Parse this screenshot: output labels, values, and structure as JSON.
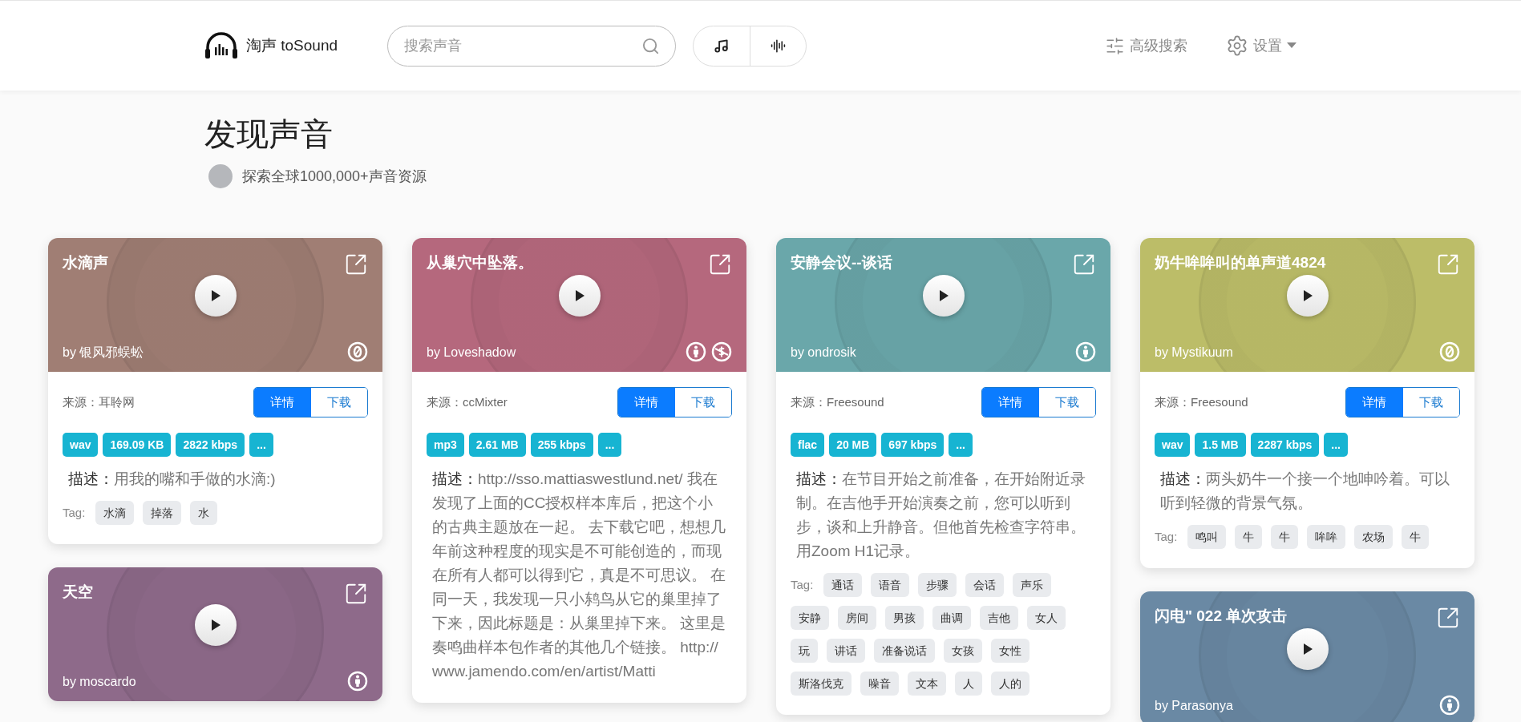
{
  "header": {
    "logo_text": "淘声 toSound",
    "search": {
      "placeholder": "搜索声音"
    },
    "mode_buttons": [
      {
        "kind": "music"
      },
      {
        "kind": "waveform"
      }
    ],
    "advanced_search": "高级搜索",
    "settings": "设置"
  },
  "page": {
    "title": "发现声音",
    "subtitle": "探索全球1000,000+声音资源"
  },
  "columns": [
    [
      {
        "title": "水滴声",
        "author": "by 银风邪蜈蚣",
        "color": "#a07e74",
        "licenses": [
          {
            "kind": "zero"
          }
        ],
        "source": "来源：耳聆网",
        "details_label": "详情",
        "download_label": "下载",
        "badges": [
          "wav",
          "169.09 KB",
          "2822 kbps",
          "..."
        ],
        "description_label": "描述：",
        "description": "用我的嘴和手做的水滴:)",
        "tag_label": "Tag:",
        "tags": [
          "水滴",
          "掉落",
          "水"
        ]
      },
      {
        "title": "天空",
        "author": "by moscardo",
        "color": "#8e6a8a",
        "licenses": [
          {
            "kind": "by"
          }
        ]
      }
    ],
    [
      {
        "title": "从巢穴中坠落。",
        "author": "by Loveshadow",
        "color": "#b5687d",
        "licenses": [
          {
            "kind": "by"
          },
          {
            "kind": "nc"
          }
        ],
        "source": "来源：ccMixter",
        "details_label": "详情",
        "download_label": "下载",
        "badges": [
          "mp3",
          "2.61 MB",
          "255 kbps",
          "..."
        ],
        "description_label": "描述：",
        "description": "http://sso.mattiaswestlund.net/ 我在发现了上面的CC授权样本库后，把这个小的古典主题放在一起。 去下载它吧，想想几年前这种程度的现实是不可能创造的，而现在所有人都可以得到它，真是不可思议。 在同一天，我发现一只小鸫鸟从它的巢里掉了下来，因此标题是：从巢里掉下来。 这里是奏鸣曲样本包作者的其他几个链接。 http://www.jamendo.com/en/artist/Matti"
      }
    ],
    [
      {
        "title": "安静会议--谈话",
        "author": "by ondrosik",
        "color": "#6aa7aa",
        "licenses": [
          {
            "kind": "by"
          }
        ],
        "source": "来源：Freesound",
        "details_label": "详情",
        "download_label": "下载",
        "badges": [
          "flac",
          "20 MB",
          "697 kbps",
          "..."
        ],
        "description_label": "描述：",
        "description": "在节目开始之前准备，在开始附近录制。在吉他手开始演奏之前，您可以听到步，谈和上升静音。但他首先检查字符串。用Zoom H1记录。",
        "tag_label": "Tag:",
        "tags": [
          "通话",
          "语音",
          "步骤",
          "会话",
          "声乐",
          "安静",
          "房间",
          "男孩",
          "曲调",
          "吉他",
          "女人",
          "玩",
          "讲话",
          "准备说话",
          "女孩",
          "女性",
          "斯洛伐克",
          "噪音",
          "文本",
          "人",
          "人的"
        ]
      }
    ],
    [
      {
        "title": "奶牛哞哞叫的单声道4824",
        "author": "by Mystikuum",
        "color": "#bcbd68",
        "licenses": [
          {
            "kind": "zero"
          }
        ],
        "source": "来源：Freesound",
        "details_label": "详情",
        "download_label": "下载",
        "badges": [
          "wav",
          "1.5 MB",
          "2287 kbps",
          "..."
        ],
        "description_label": "描述：",
        "description": "两头奶牛一个接一个地呻吟着。可以听到轻微的背景气氛。",
        "tag_label": "Tag:",
        "tags": [
          "鸣叫",
          "牛",
          "牛",
          "哞哞",
          "农场",
          "牛"
        ]
      },
      {
        "title": "闪电\" 022 单次攻击",
        "author": "by Parasonya",
        "color": "#6a89a4",
        "licenses": [
          {
            "kind": "by"
          }
        ]
      }
    ]
  ]
}
